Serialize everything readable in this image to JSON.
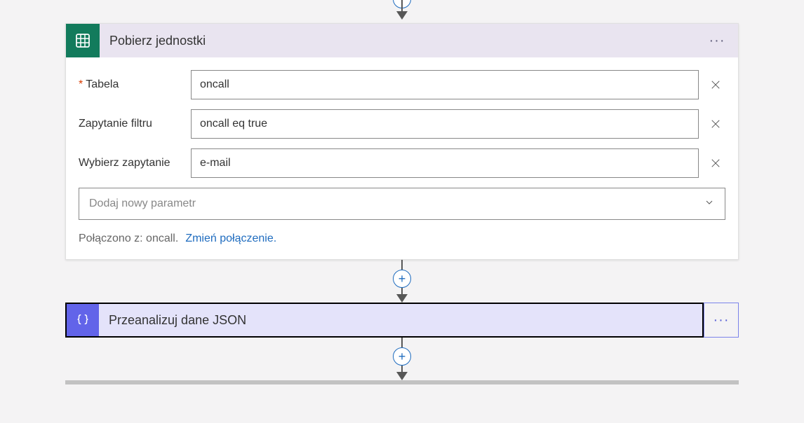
{
  "top_arrow": true,
  "card1": {
    "title": "Pobierz jednostki",
    "fields": {
      "table": {
        "label": "Tabela",
        "required": true,
        "value": "oncall",
        "has_clear": true
      },
      "filter": {
        "label": "Zapytanie filtru",
        "required": false,
        "value": "oncall eq true",
        "has_clear": true
      },
      "select": {
        "label": "Wybierz zapytanie",
        "required": false,
        "value": "e-mail",
        "has_clear": true
      }
    },
    "add_param_placeholder": "Dodaj nowy parametr",
    "connected_text": "Połączono z: oncall.",
    "change_connection": "Zmień połączenie."
  },
  "card2": {
    "title": "Przeanalizuj dane JSON"
  }
}
